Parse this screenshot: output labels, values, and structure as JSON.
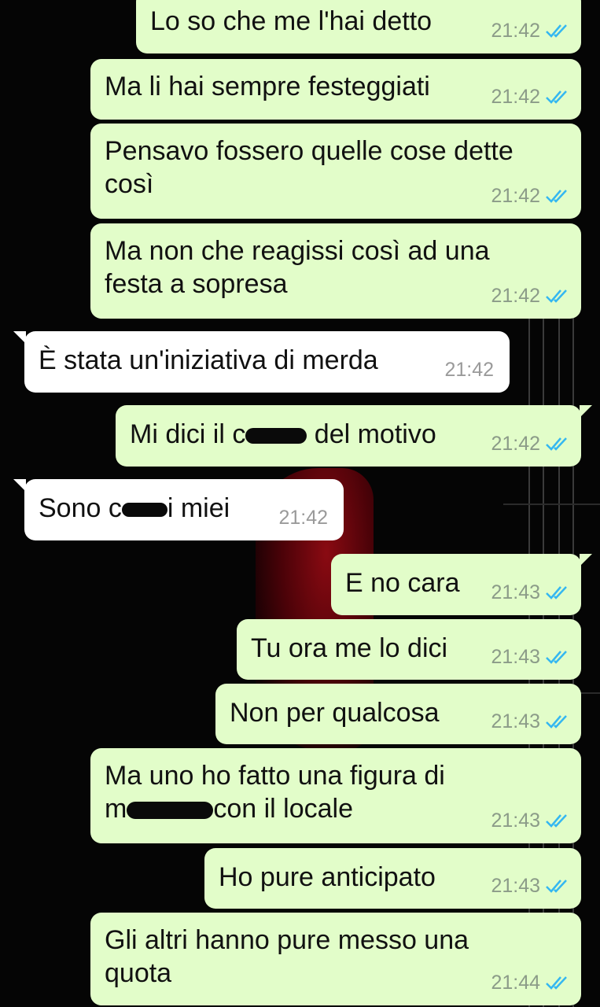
{
  "messages": [
    {
      "dir": "out",
      "text": "Lo so che me l'hai detto",
      "time": "21:42"
    },
    {
      "dir": "out",
      "text": "Ma li hai sempre festeggiati",
      "time": "21:42"
    },
    {
      "dir": "out",
      "text": "Pensavo fossero quelle cose dette\ncosì",
      "time": "21:42"
    },
    {
      "dir": "out",
      "text": "Ma non che reagissi così ad una\nfesta a sopresa",
      "time": "21:42"
    },
    {
      "dir": "in",
      "text": "È stata un'iniziativa di merda",
      "time": "21:42"
    },
    {
      "dir": "out",
      "text_before": "Mi dici il c",
      "text_after": " del motivo",
      "time": "21:42"
    },
    {
      "dir": "in",
      "text_before": "Sono c",
      "text_after": "i miei",
      "time": "21:42"
    },
    {
      "dir": "out",
      "text": "E no cara",
      "time": "21:43"
    },
    {
      "dir": "out",
      "text": "Tu ora me lo dici",
      "time": "21:43"
    },
    {
      "dir": "out",
      "text": "Non per qualcosa",
      "time": "21:43"
    },
    {
      "dir": "out",
      "text_line1": "Ma uno ho fatto una figura di",
      "text_before": "m",
      "text_after": "con il locale",
      "time": "21:43"
    },
    {
      "dir": "out",
      "text": "Ho pure anticipato",
      "time": "21:43"
    },
    {
      "dir": "out",
      "text": "Gli altri hanno pure messo una\nquota",
      "time": "21:44"
    }
  ],
  "colors": {
    "outgoing": "#e2fdc9",
    "incoming": "#ffffff",
    "read_ticks": "#34b7f1",
    "background": "#050505"
  },
  "icons": {
    "read_receipt": "double-check-icon"
  }
}
